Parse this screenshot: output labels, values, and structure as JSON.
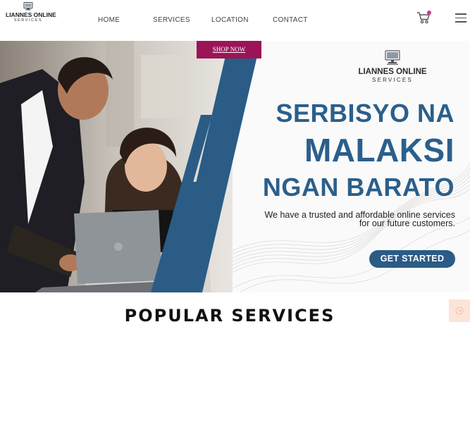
{
  "logo": {
    "name": "LIANNES ONLINE",
    "sub": "SERVICES",
    "icon": "monitor-icon"
  },
  "nav": {
    "home": "HOME",
    "services": "SERVICES",
    "location": "LOCATION",
    "contact": "CONTACT"
  },
  "header_icons": {
    "cart": "cart-icon",
    "menu": "hamburger-menu-icon"
  },
  "colors": {
    "accent_blue": "#2b5f8b",
    "cta_blue": "#2a5c86",
    "shop_now_bg": "#9b1458",
    "badge": "#d63384",
    "float_btn": "#fde4d8"
  },
  "hero": {
    "shop_now": "SHOP NOW",
    "brand_name": "LIANNES ONLINE",
    "brand_sub": "SERVICES",
    "headline_1": "SERBISYO NA",
    "headline_2": "MALAKSI",
    "headline_3": "NGAN BARATO",
    "tagline_1": "We have a trusted and affordable online services",
    "tagline_2": "for our future customers.",
    "cta": "GET STARTED"
  },
  "section": {
    "title": "POPULAR SERVICES"
  }
}
